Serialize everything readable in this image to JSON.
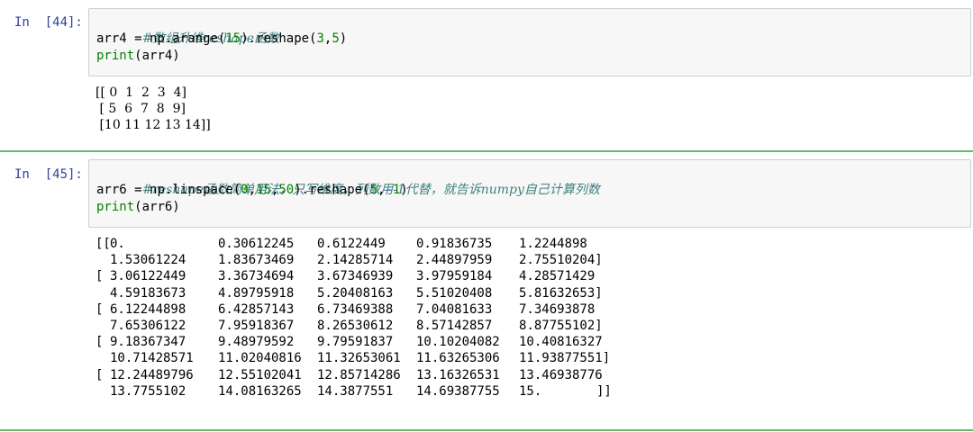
{
  "cells": [
    {
      "prompt": "In  [44]:",
      "code": {
        "comment": "#数组升维reshape函数",
        "line2_var": "arr4",
        "line2_eq": " = ",
        "line2_mod": "np.",
        "line2_fn": "arange",
        "line2_open": "(",
        "line2_arg": "15",
        "line2_mid": ").reshape(",
        "line2_a1": "3",
        "line2_comma": ",",
        "line2_a2": "5",
        "line2_close": ")",
        "line3_print": "print",
        "line3_rest": "(arr4)"
      },
      "output": [
        "[[ 0  1  2  3  4]",
        " [ 5  6  7  8  9]",
        " [10 11 12 13 14]]"
      ]
    },
    {
      "prompt": "In  [45]:",
      "code": {
        "comment": "#reshape函数简单用法，只写维度，列数用-1代替，就告诉numpy自己计算列数",
        "line2_var": "arr6",
        "line2_eq": " = ",
        "line2_mod": "np.",
        "line2_fn": "linspace",
        "line2_open": "(",
        "line2_a0": "0",
        "line2_c0": ",",
        "line2_a1": "15",
        "line2_c1": ",",
        "line2_a2": "50",
        "line2_mid": ").reshape(",
        "line2_a3": "5",
        "line2_c2": ",",
        "line2_minus": "-",
        "line2_a4": "1",
        "line2_close": ")",
        "line3_print": "print",
        "line3_rest": "(arr6)"
      },
      "output_rows": [
        [
          "[[",
          "0.",
          "0.30612245",
          "0.6122449",
          "0.91836735",
          "1.2244898",
          ""
        ],
        [
          "",
          "1.53061224",
          "1.83673469",
          "2.14285714",
          "2.44897959",
          "2.75510204]",
          ""
        ],
        [
          "[",
          "3.06122449",
          "3.36734694",
          "3.67346939",
          "3.97959184",
          "4.28571429",
          ""
        ],
        [
          "",
          "4.59183673",
          "4.89795918",
          "5.20408163",
          "5.51020408",
          "5.81632653]",
          ""
        ],
        [
          "[",
          "6.12244898",
          "6.42857143",
          "6.73469388",
          "7.04081633",
          "7.34693878",
          ""
        ],
        [
          "",
          "7.65306122",
          "7.95918367",
          "8.26530612",
          "8.57142857",
          "8.87755102]",
          ""
        ],
        [
          "[",
          "9.18367347",
          "9.48979592",
          "9.79591837",
          "10.10204082",
          "10.40816327",
          ""
        ],
        [
          "",
          "10.71428571",
          "11.02040816",
          "11.32653061",
          "11.63265306",
          "11.93877551]",
          ""
        ],
        [
          "[",
          "12.24489796",
          "12.55102041",
          "12.85714286",
          "13.16326531",
          "13.46938776",
          ""
        ],
        [
          "",
          "13.7755102",
          "14.08163265",
          "14.3877551",
          "14.69387755",
          "15.",
          "]]"
        ]
      ]
    }
  ]
}
